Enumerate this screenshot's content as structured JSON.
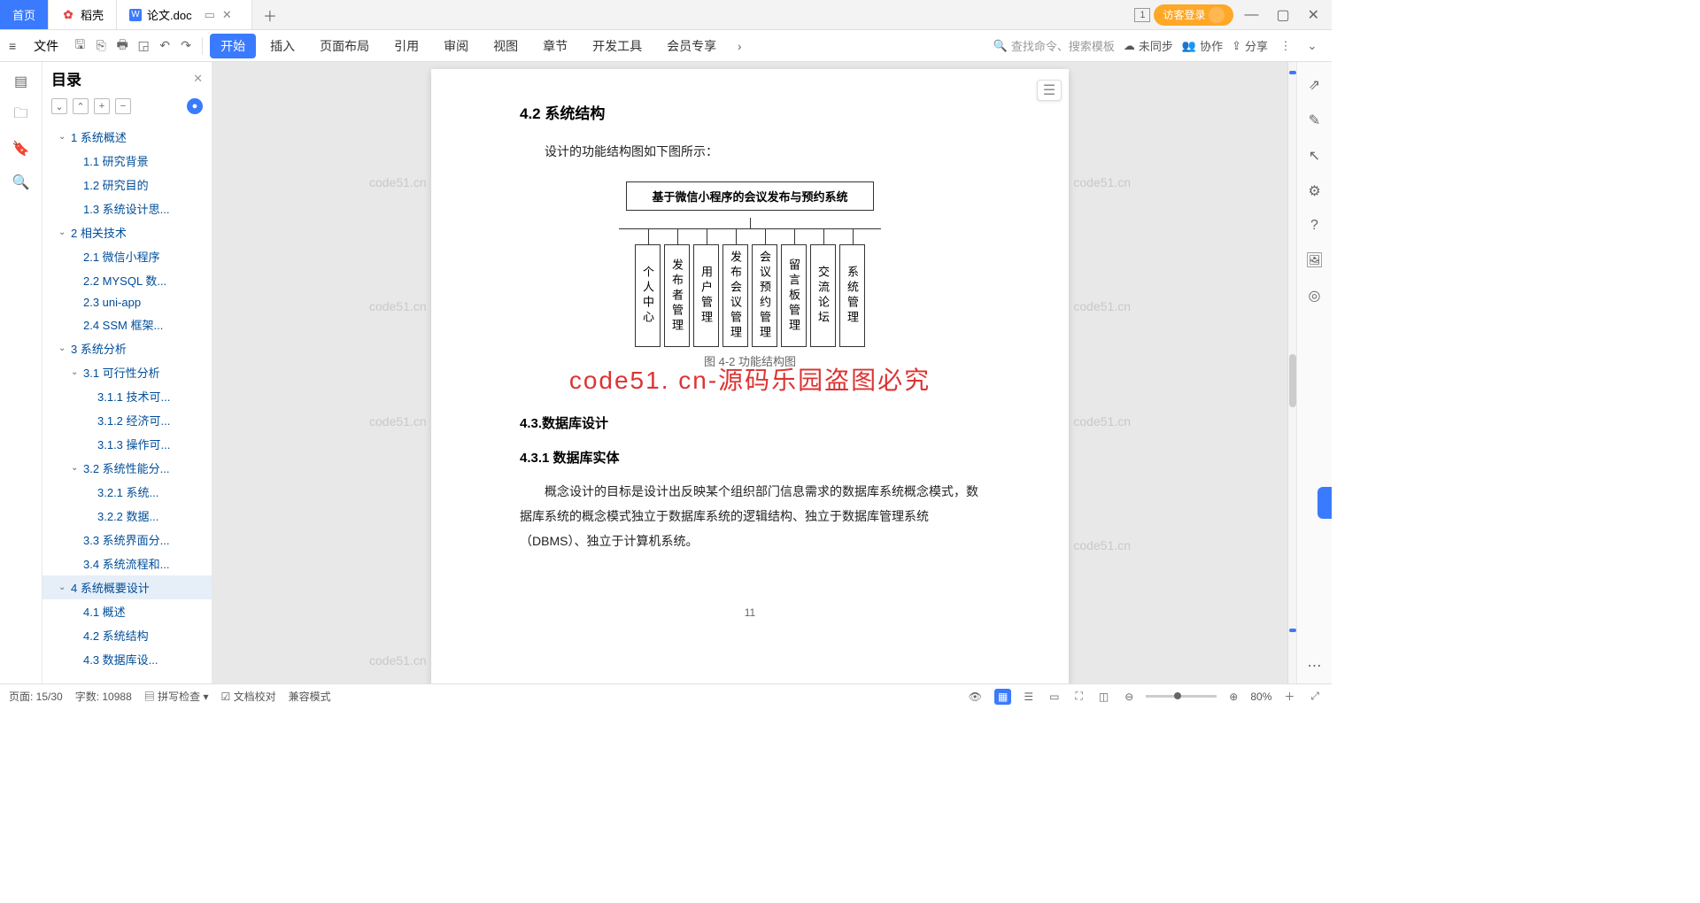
{
  "tabs": {
    "home": "首页",
    "daoke": "稻壳",
    "doc": "论文.doc"
  },
  "login": "访客登录",
  "ribbon": {
    "file": "文件",
    "tabs": [
      "开始",
      "插入",
      "页面布局",
      "引用",
      "审阅",
      "视图",
      "章节",
      "开发工具",
      "会员专享"
    ],
    "search_ph": "查找命令、搜索模板",
    "sync": "未同步",
    "collab": "协作",
    "share": "分享"
  },
  "outline": {
    "title": "目录",
    "items": [
      {
        "l": 1,
        "t": "1 系统概述",
        "c": 1
      },
      {
        "l": 2,
        "t": "1.1 研究背景"
      },
      {
        "l": 2,
        "t": "1.2 研究目的"
      },
      {
        "l": 2,
        "t": "1.3 系统设计思..."
      },
      {
        "l": 1,
        "t": "2 相关技术",
        "c": 1
      },
      {
        "l": 2,
        "t": "2.1 微信小程序"
      },
      {
        "l": 2,
        "t": "2.2 MYSQL 数..."
      },
      {
        "l": 2,
        "t": "2.3 uni-app"
      },
      {
        "l": 2,
        "t": "2.4 SSM 框架..."
      },
      {
        "l": 1,
        "t": "3 系统分析",
        "c": 1
      },
      {
        "l": 2,
        "t": "3.1 可行性分析",
        "c": 1
      },
      {
        "l": 3,
        "t": "3.1.1 技术可..."
      },
      {
        "l": 3,
        "t": "3.1.2 经济可..."
      },
      {
        "l": 3,
        "t": "3.1.3 操作可..."
      },
      {
        "l": 2,
        "t": "3.2 系统性能分...",
        "c": 1
      },
      {
        "l": 3,
        "t": "3.2.1 系统..."
      },
      {
        "l": 3,
        "t": "3.2.2 数据..."
      },
      {
        "l": 2,
        "t": "3.3 系统界面分..."
      },
      {
        "l": 2,
        "t": "3.4 系统流程和..."
      },
      {
        "l": 1,
        "t": "4 系统概要设计",
        "c": 1,
        "sel": 1
      },
      {
        "l": 2,
        "t": "4.1 概述"
      },
      {
        "l": 2,
        "t": "4.2 系统结构"
      },
      {
        "l": 2,
        "t": "4.3 数据库设..."
      }
    ]
  },
  "doc": {
    "h42": "4.2 系统结构",
    "intro": "设计的功能结构图如下图所示：",
    "root": "基于微信小程序的会议发布与预约系统",
    "leaves": [
      "个人中心",
      "发布者管理",
      "用户管理",
      "发布会议管理",
      "会议预约管理",
      "留言板管理",
      "交流论坛",
      "系统管理"
    ],
    "caption": "图 4-2 功能结构图",
    "h43": "4.3.数据库设计",
    "h431": "4.3.1 数据库实体",
    "body": "概念设计的目标是设计出反映某个组织部门信息需求的数据库系统概念模式，数据库系统的概念模式独立于数据库系统的逻辑结构、独立于数据库管理系统（DBMS）、独立于计算机系统。",
    "pgnum": "11",
    "overlay": "code51. cn-源码乐园盗图必究",
    "wm": "code51.cn"
  },
  "status": {
    "page": "页面: 15/30",
    "words": "字数: 10988",
    "spell": "拼写检查",
    "proof": "文档校对",
    "compat": "兼容模式",
    "zoom": "80%"
  }
}
